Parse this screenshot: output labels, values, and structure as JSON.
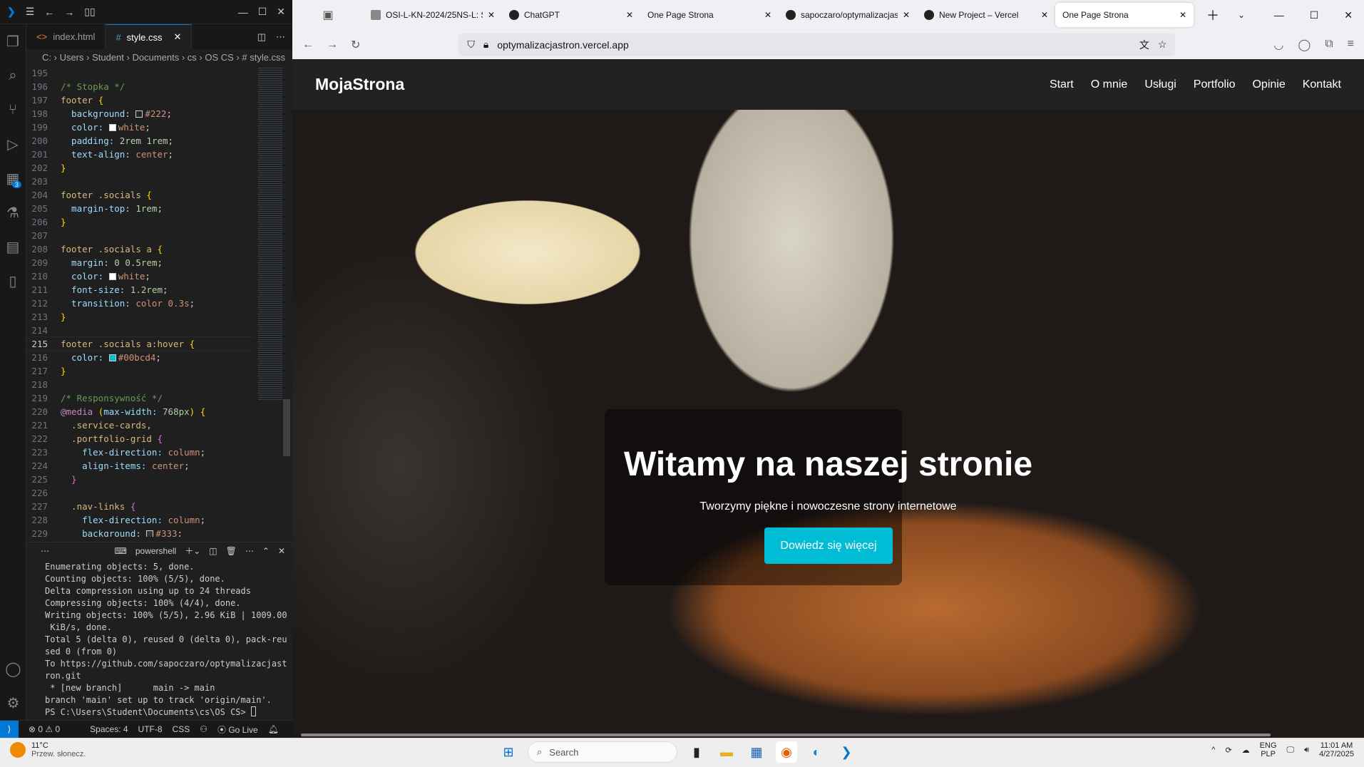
{
  "vscode": {
    "tabs": [
      {
        "label": "index.html",
        "icon": "<>"
      },
      {
        "label": "style.css",
        "icon": "#"
      }
    ],
    "breadcrumb": [
      "C:",
      "Users",
      "Student",
      "Documents",
      "cs",
      "OS CS",
      "# style.css"
    ],
    "code": [
      {
        "n": "195",
        "seg": []
      },
      {
        "n": "196",
        "seg": [
          [
            "c-cm",
            "/* Stopka */"
          ]
        ]
      },
      {
        "n": "197",
        "seg": [
          [
            "c-sel",
            "footer "
          ],
          [
            "c-br",
            "{"
          ]
        ]
      },
      {
        "n": "198",
        "seg": [
          [
            "c-pr",
            "  background: "
          ],
          [
            "sw",
            "#222"
          ],
          [
            "c-vl",
            "#222"
          ],
          [
            "c-pn",
            ";"
          ]
        ]
      },
      {
        "n": "199",
        "seg": [
          [
            "c-pr",
            "  color: "
          ],
          [
            "sw",
            "#ffffff"
          ],
          [
            "c-vl",
            "white"
          ],
          [
            "c-pn",
            ";"
          ]
        ]
      },
      {
        "n": "200",
        "seg": [
          [
            "c-pr",
            "  padding: "
          ],
          [
            "c-nm",
            "2rem 1rem"
          ],
          [
            "c-pn",
            ";"
          ]
        ]
      },
      {
        "n": "201",
        "seg": [
          [
            "c-pr",
            "  text-align: "
          ],
          [
            "c-vl",
            "center"
          ],
          [
            "c-pn",
            ";"
          ]
        ]
      },
      {
        "n": "202",
        "seg": [
          [
            "c-br",
            "}"
          ]
        ]
      },
      {
        "n": "203",
        "seg": []
      },
      {
        "n": "204",
        "seg": [
          [
            "c-sel",
            "footer .socials "
          ],
          [
            "c-br",
            "{"
          ]
        ]
      },
      {
        "n": "205",
        "seg": [
          [
            "c-pr",
            "  margin-top: "
          ],
          [
            "c-nm",
            "1rem"
          ],
          [
            "c-pn",
            ";"
          ]
        ]
      },
      {
        "n": "206",
        "seg": [
          [
            "c-br",
            "}"
          ]
        ]
      },
      {
        "n": "207",
        "seg": []
      },
      {
        "n": "208",
        "seg": [
          [
            "c-sel",
            "footer .socials a "
          ],
          [
            "c-br",
            "{"
          ]
        ]
      },
      {
        "n": "209",
        "seg": [
          [
            "c-pr",
            "  margin: "
          ],
          [
            "c-nm",
            "0 0.5rem"
          ],
          [
            "c-pn",
            ";"
          ]
        ]
      },
      {
        "n": "210",
        "seg": [
          [
            "c-pr",
            "  color: "
          ],
          [
            "sw",
            "#ffffff"
          ],
          [
            "c-vl",
            "white"
          ],
          [
            "c-pn",
            ";"
          ]
        ]
      },
      {
        "n": "211",
        "seg": [
          [
            "c-pr",
            "  font-size: "
          ],
          [
            "c-nm",
            "1.2rem"
          ],
          [
            "c-pn",
            ";"
          ]
        ]
      },
      {
        "n": "212",
        "seg": [
          [
            "c-pr",
            "  transition: "
          ],
          [
            "c-vl",
            "color 0.3s"
          ],
          [
            "c-pn",
            ";"
          ]
        ]
      },
      {
        "n": "213",
        "seg": [
          [
            "c-br",
            "}"
          ]
        ]
      },
      {
        "n": "214",
        "seg": []
      },
      {
        "n": "215",
        "cur": true,
        "seg": [
          [
            "c-sel",
            "footer .socials a:hover "
          ],
          [
            "c-br",
            "{"
          ]
        ]
      },
      {
        "n": "216",
        "seg": [
          [
            "c-pr",
            "  color: "
          ],
          [
            "sw",
            "#00bcd4"
          ],
          [
            "c-vl",
            "#00bcd4"
          ],
          [
            "c-pn",
            ";"
          ]
        ]
      },
      {
        "n": "217",
        "seg": [
          [
            "c-br",
            "}"
          ]
        ]
      },
      {
        "n": "218",
        "seg": []
      },
      {
        "n": "219",
        "seg": [
          [
            "c-cm",
            "/* Responsywność */"
          ]
        ]
      },
      {
        "n": "220",
        "seg": [
          [
            "c-at",
            "@media "
          ],
          [
            "c-br",
            "("
          ],
          [
            "c-pr",
            "max-width: "
          ],
          [
            "c-nm",
            "768px"
          ],
          [
            "c-br",
            ") {"
          ]
        ]
      },
      {
        "n": "221",
        "seg": [
          [
            "c-sel",
            "  .service-cards,"
          ]
        ]
      },
      {
        "n": "222",
        "seg": [
          [
            "c-sel",
            "  .portfolio-grid "
          ],
          [
            "c-br2",
            "{"
          ]
        ]
      },
      {
        "n": "223",
        "seg": [
          [
            "c-pr",
            "    flex-direction: "
          ],
          [
            "c-vl",
            "column"
          ],
          [
            "c-pn",
            ";"
          ]
        ]
      },
      {
        "n": "224",
        "seg": [
          [
            "c-pr",
            "    align-items: "
          ],
          [
            "c-vl",
            "center"
          ],
          [
            "c-pn",
            ";"
          ]
        ]
      },
      {
        "n": "225",
        "seg": [
          [
            "c-br2",
            "  }"
          ]
        ]
      },
      {
        "n": "226",
        "seg": []
      },
      {
        "n": "227",
        "seg": [
          [
            "c-sel",
            "  .nav-links "
          ],
          [
            "c-br2",
            "{"
          ]
        ]
      },
      {
        "n": "228",
        "seg": [
          [
            "c-pr",
            "    flex-direction: "
          ],
          [
            "c-vl",
            "column"
          ],
          [
            "c-pn",
            ";"
          ]
        ]
      },
      {
        "n": "229",
        "seg": [
          [
            "c-pr",
            "    background: "
          ],
          [
            "sw",
            "#333"
          ],
          [
            "c-vl",
            "#333"
          ],
          [
            "c-pn",
            ";"
          ]
        ]
      }
    ],
    "terminal": {
      "label": "powershell",
      "lines": [
        "Enumerating objects: 5, done.",
        "Counting objects: 100% (5/5), done.",
        "Delta compression using up to 24 threads",
        "Compressing objects: 100% (4/4), done.",
        "Writing objects: 100% (5/5), 2.96 KiB | 1009.00",
        " KiB/s, done.",
        "Total 5 (delta 0), reused 0 (delta 0), pack-reu",
        "sed 0 (from 0)",
        "To https://github.com/sapoczaro/optymalizacjast",
        "ron.git",
        " * [new branch]      main -> main",
        "branch 'main' set up to track 'origin/main'."
      ],
      "prompt": "PS C:\\Users\\Student\\Documents\\cs\\OS CS> "
    },
    "status": {
      "problems": "⊗ 0 ⚠ 0",
      "spaces": "Spaces: 4",
      "encoding": "UTF-8",
      "lang": "CSS",
      "golive": "Go Live"
    },
    "badge": "3"
  },
  "browser": {
    "tabs": [
      {
        "label": "OSI-L-KN-2024/25NS-L: S"
      },
      {
        "label": "ChatGPT"
      },
      {
        "label": "One Page Strona"
      },
      {
        "label": "sapoczaro/optymalizacjas"
      },
      {
        "label": "New Project – Vercel"
      },
      {
        "label": "One Page Strona",
        "active": true
      }
    ],
    "url": "optymalizacjastron.vercel.app"
  },
  "site": {
    "logo": "MojaStrona",
    "menu": [
      "Start",
      "O mnie",
      "Usługi",
      "Portfolio",
      "Opinie",
      "Kontakt"
    ],
    "title": "Witamy na naszej stronie",
    "subtitle": "Tworzymy piękne i nowoczesne strony internetowe",
    "cta": "Dowiedz się więcej",
    "accent": "#00bcd4"
  },
  "taskbar": {
    "temp": "11°C",
    "weather": "Przew. słonecz.",
    "search": "Search",
    "lang1": "ENG",
    "lang2": "PLP",
    "time": "11:01 AM",
    "date": "4/27/2025"
  }
}
